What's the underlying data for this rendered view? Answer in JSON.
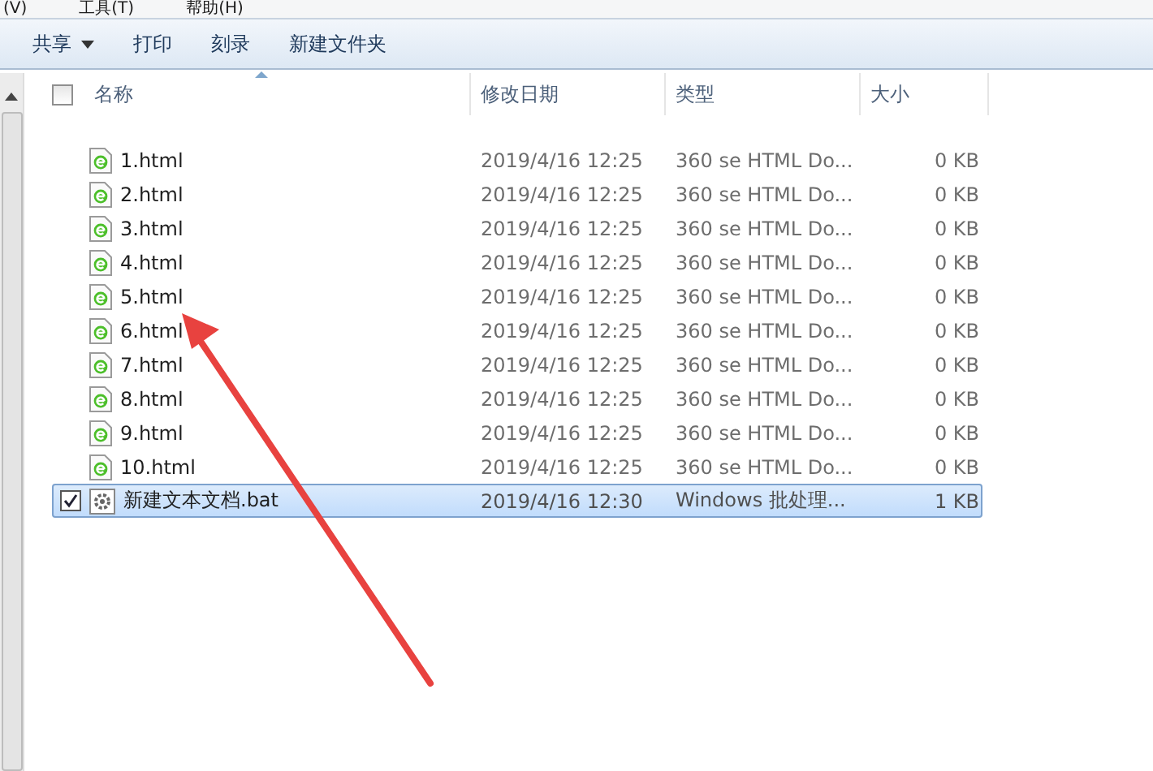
{
  "menu_bar": [
    "(V)",
    "工具(T)",
    "帮助(H)"
  ],
  "toolbar": [
    {
      "label": "共享",
      "dropdown": true
    },
    {
      "label": "打印",
      "dropdown": false
    },
    {
      "label": "刻录",
      "dropdown": false
    },
    {
      "label": "新建文件夹",
      "dropdown": false
    }
  ],
  "table": {
    "select_all_checked": false,
    "columns": [
      "名称",
      "修改日期",
      "类型",
      "大小"
    ],
    "rows": [
      {
        "kind": "html",
        "name": "1.html",
        "date": "2019/4/16 12:25",
        "type": "360 se HTML Do...",
        "size": "0 KB",
        "selected": false,
        "checked": false
      },
      {
        "kind": "html",
        "name": "2.html",
        "date": "2019/4/16 12:25",
        "type": "360 se HTML Do...",
        "size": "0 KB",
        "selected": false,
        "checked": false
      },
      {
        "kind": "html",
        "name": "3.html",
        "date": "2019/4/16 12:25",
        "type": "360 se HTML Do...",
        "size": "0 KB",
        "selected": false,
        "checked": false
      },
      {
        "kind": "html",
        "name": "4.html",
        "date": "2019/4/16 12:25",
        "type": "360 se HTML Do...",
        "size": "0 KB",
        "selected": false,
        "checked": false
      },
      {
        "kind": "html",
        "name": "5.html",
        "date": "2019/4/16 12:25",
        "type": "360 se HTML Do...",
        "size": "0 KB",
        "selected": false,
        "checked": false
      },
      {
        "kind": "html",
        "name": "6.html",
        "date": "2019/4/16 12:25",
        "type": "360 se HTML Do...",
        "size": "0 KB",
        "selected": false,
        "checked": false
      },
      {
        "kind": "html",
        "name": "7.html",
        "date": "2019/4/16 12:25",
        "type": "360 se HTML Do...",
        "size": "0 KB",
        "selected": false,
        "checked": false
      },
      {
        "kind": "html",
        "name": "8.html",
        "date": "2019/4/16 12:25",
        "type": "360 se HTML Do...",
        "size": "0 KB",
        "selected": false,
        "checked": false
      },
      {
        "kind": "html",
        "name": "9.html",
        "date": "2019/4/16 12:25",
        "type": "360 se HTML Do...",
        "size": "0 KB",
        "selected": false,
        "checked": false
      },
      {
        "kind": "html",
        "name": "10.html",
        "date": "2019/4/16 12:25",
        "type": "360 se HTML Do...",
        "size": "0 KB",
        "selected": false,
        "checked": false
      },
      {
        "kind": "bat",
        "name": "新建文本文档.bat",
        "date": "2019/4/16 12:30",
        "type": "Windows 批处理...",
        "size": "1 KB",
        "selected": true,
        "checked": true
      }
    ]
  }
}
